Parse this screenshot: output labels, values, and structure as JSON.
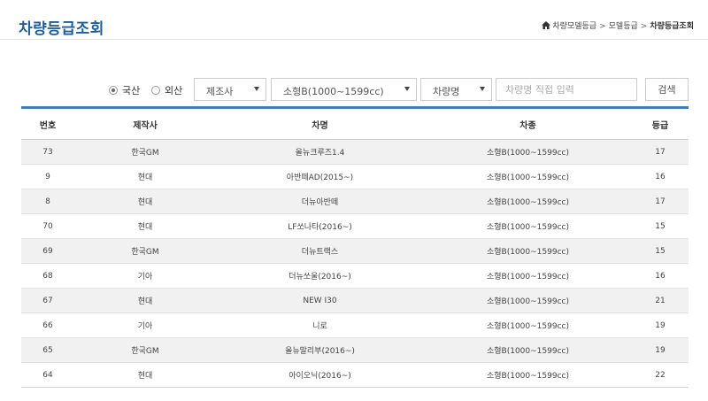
{
  "header": {
    "title": "차량등급조회",
    "breadcrumb": {
      "item1": "차량모델등급",
      "separator": ">",
      "item2": "모델등급",
      "current": "차량등급조회"
    }
  },
  "search": {
    "radio_domestic": "국산",
    "radio_foreign": "외산",
    "radio_selected": "국산",
    "manufacturer_select": "제조사",
    "size_select": "소형B(1000~1599cc)",
    "model_select": "차량명",
    "name_input_placeholder": "차량명 직접 입력",
    "search_button": "검색"
  },
  "table": {
    "columns": [
      "번호",
      "제작사",
      "차명",
      "차종",
      "등급"
    ],
    "rows": [
      {
        "no": "73",
        "maker": "한국GM",
        "name": "올뉴크루즈1.4",
        "type": "소형B(1000~1599cc)",
        "grade": "17"
      },
      {
        "no": "9",
        "maker": "현대",
        "name": "아반떼AD(2015~)",
        "type": "소형B(1000~1599cc)",
        "grade": "16"
      },
      {
        "no": "8",
        "maker": "현대",
        "name": "더뉴아반떼",
        "type": "소형B(1000~1599cc)",
        "grade": "17"
      },
      {
        "no": "70",
        "maker": "현대",
        "name": "LF쏘나타(2016~)",
        "type": "소형B(1000~1599cc)",
        "grade": "15"
      },
      {
        "no": "69",
        "maker": "한국GM",
        "name": "더뉴트랙스",
        "type": "소형B(1000~1599cc)",
        "grade": "15"
      },
      {
        "no": "68",
        "maker": "기아",
        "name": "더뉴쏘울(2016~)",
        "type": "소형B(1000~1599cc)",
        "grade": "16"
      },
      {
        "no": "67",
        "maker": "현대",
        "name": "NEW I30",
        "type": "소형B(1000~1599cc)",
        "grade": "21"
      },
      {
        "no": "66",
        "maker": "기아",
        "name": "니로",
        "type": "소형B(1000~1599cc)",
        "grade": "19"
      },
      {
        "no": "65",
        "maker": "한국GM",
        "name": "올뉴말리부(2016~)",
        "type": "소형B(1000~1599cc)",
        "grade": "19"
      },
      {
        "no": "64",
        "maker": "현대",
        "name": "아이오닉(2016~)",
        "type": "소형B(1000~1599cc)",
        "grade": "22"
      }
    ]
  }
}
